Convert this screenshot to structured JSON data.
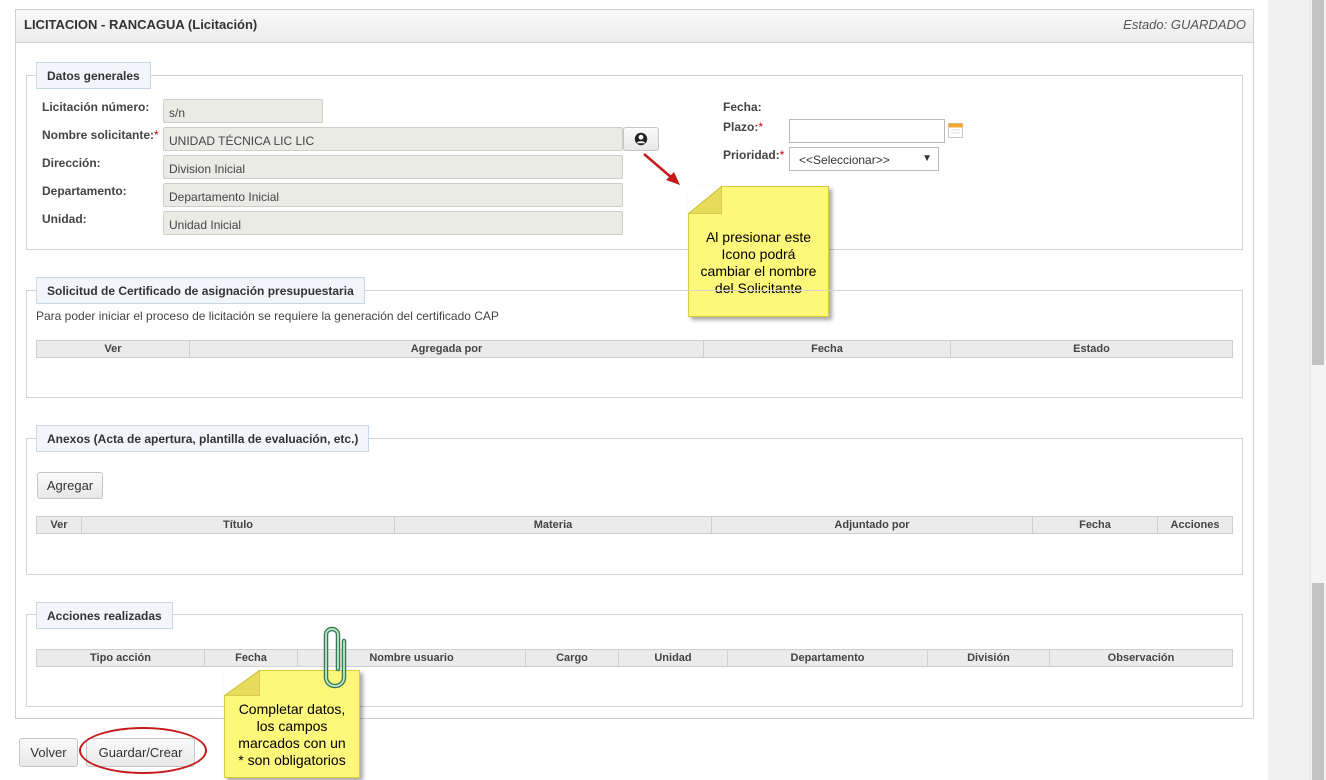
{
  "header": {
    "title": "LICITACION - RANCAGUA (Licitación)",
    "status": "Estado: GUARDADO"
  },
  "datos_generales": {
    "legend": "Datos generales",
    "fields": {
      "numero": {
        "label": "Licitación número:",
        "value": "s/n"
      },
      "solicitante": {
        "label": "Nombre solicitante:",
        "required": "*",
        "value": "UNIDAD TÉCNICA LIC LIC"
      },
      "direccion": {
        "label": "Dirección:",
        "value": "Division Inicial"
      },
      "departamento": {
        "label": "Departamento:",
        "value": "Departamento Inicial"
      },
      "unidad": {
        "label": "Unidad:",
        "value": "Unidad Inicial"
      },
      "fecha": {
        "label": "Fecha:"
      },
      "plazo": {
        "label": "Plazo:",
        "required": "*",
        "value": ""
      },
      "prioridad": {
        "label": "Prioridad:",
        "required": "*",
        "value": "<<Seleccionar>>",
        "arrow": "▼"
      }
    }
  },
  "solicitud": {
    "legend": "Solicitud de Certificado de asignación presupuestaria",
    "description": "Para poder iniciar el proceso de licitación se requiere la generación del certificado CAP",
    "columns": [
      "Ver",
      "Agregada por",
      "Fecha",
      "Estado"
    ]
  },
  "anexos": {
    "legend": "Anexos (Acta de apertura, plantilla de evaluación, etc.)",
    "add_button": "Agregar",
    "columns": [
      "Ver",
      "Título",
      "Materia",
      "Adjuntado por",
      "Fecha",
      "Acciones"
    ]
  },
  "acciones": {
    "legend": "Acciones realizadas",
    "columns": [
      "Tipo acción",
      "Fecha",
      "Nombre usuario",
      "Cargo",
      "Unidad",
      "Departamento",
      "División",
      "Observación"
    ]
  },
  "footer": {
    "back_button": "Volver",
    "save_button": "Guardar/Crear"
  },
  "notes": {
    "icon_note": [
      "Al presionar este",
      "Icono podrá",
      "cambiar el nombre",
      "del Solicitante"
    ],
    "required_note": [
      "Completar datos,",
      "los campos",
      "marcados con un",
      "* son obligatorios"
    ]
  },
  "icons": {
    "user": "user-icon",
    "calendar": "calendar-icon",
    "paperclip": "paperclip-icon"
  },
  "colors": {
    "note_yellow": "#fdf77a",
    "annotation_red": "#c41a1a",
    "legend_bg": "#f2f6fa"
  }
}
